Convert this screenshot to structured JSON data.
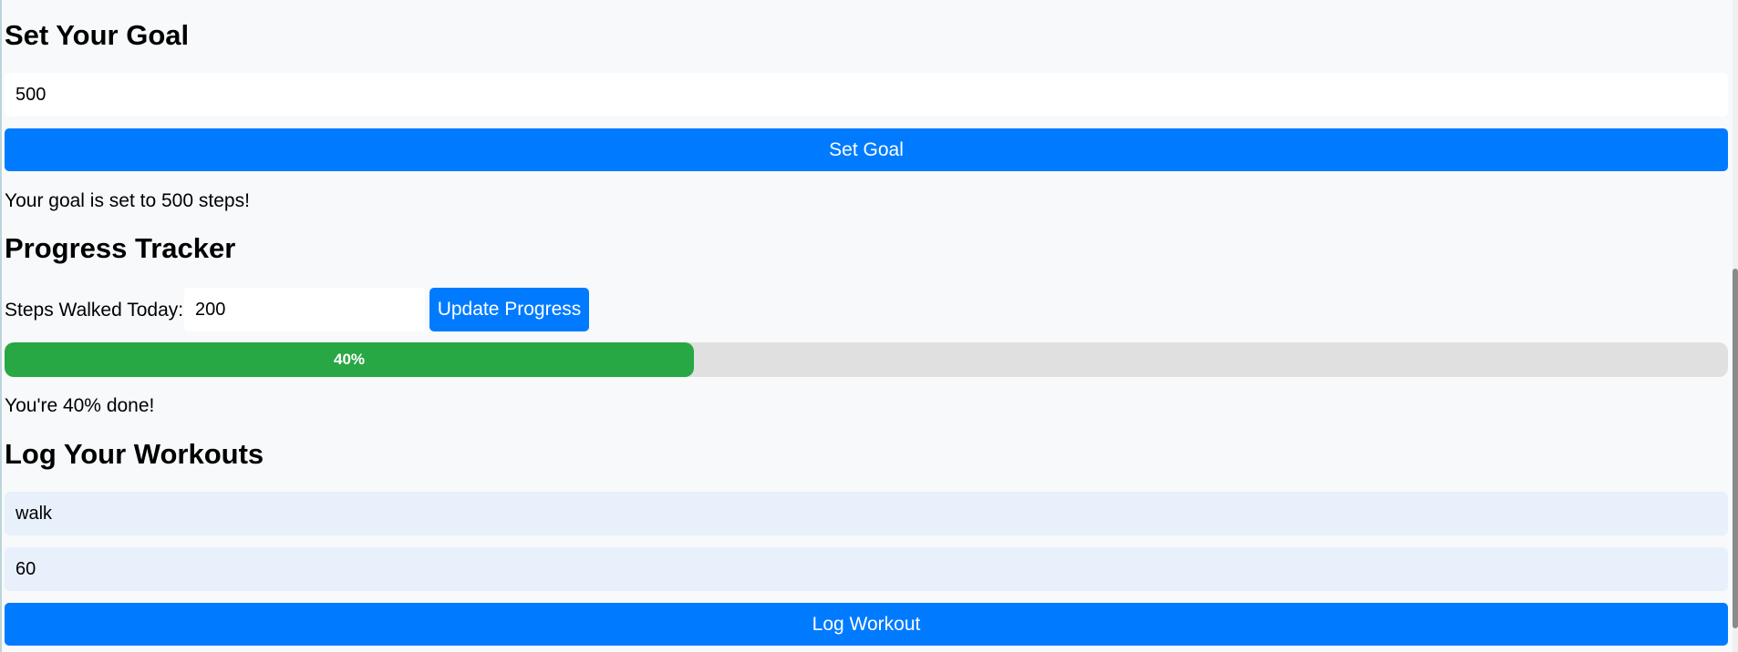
{
  "goal": {
    "heading": "Set Your Goal",
    "input_value": "500",
    "button_label": "Set Goal",
    "message": "Your goal is set to 500 steps!"
  },
  "progress": {
    "heading": "Progress Tracker",
    "steps_label": "Steps Walked Today:",
    "steps_value": "200",
    "button_label": "Update Progress",
    "percent": 40,
    "bar_label": "40%",
    "message": "You're 40% done!",
    "fill_color": "#28a745"
  },
  "workouts": {
    "heading": "Log Your Workouts",
    "type_value": "walk",
    "duration_value": "60",
    "button_label": "Log Workout"
  },
  "colors": {
    "accent": "#007bff",
    "background": "#f7f9fb"
  }
}
